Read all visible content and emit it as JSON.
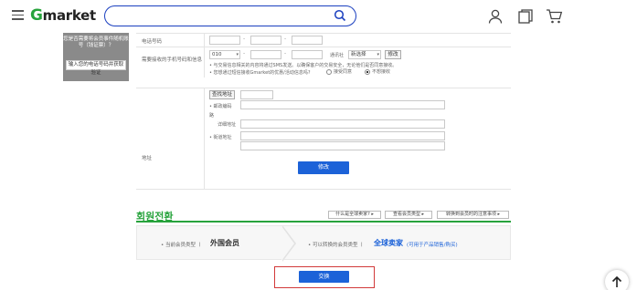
{
  "header": {
    "logo_g": "G",
    "logo_rest": "market",
    "search_placeholder": ""
  },
  "left_panel": {
    "text": "您是否需要将会员事件随机账号（钱证票）？",
    "button": "输入您的电话号码并获取验证"
  },
  "form": {
    "phone_label": "电话号码",
    "phone_sep": "-",
    "mobile_label": "需要接收的手机号码和信息",
    "mobile_prefix": "010",
    "carrier_label": "通讯社",
    "carrier_value": "新选择",
    "modify_small": "修改",
    "sms_note": "与交易信息相关的内容将通过SMS发送。以确保客户的交易安全，无论他们是否同意接收。",
    "promo_question": "您想通过短信接收Gmarket的优惠/活动信息吗?",
    "agree": "接受同意",
    "disagree": "不想接收",
    "address_label": "地址",
    "find_address": "查找地址",
    "postal_label": "邮政编码",
    "road_label": "路",
    "detail_label": "详细地址",
    "street_label": "街道地址",
    "submit": "修改"
  },
  "membership": {
    "title": "회원전환",
    "btn1": "什么是全球卖家?",
    "btn2": "查看会员类型",
    "btn3": "转换到会员时的注意事项",
    "current_label": "当前会员类型",
    "current_value": "外国会员",
    "target_label": "可以转换的会员类型",
    "target_value": "全球卖家",
    "target_note": "(可用于产品销售/购买)",
    "convert": "交换"
  }
}
